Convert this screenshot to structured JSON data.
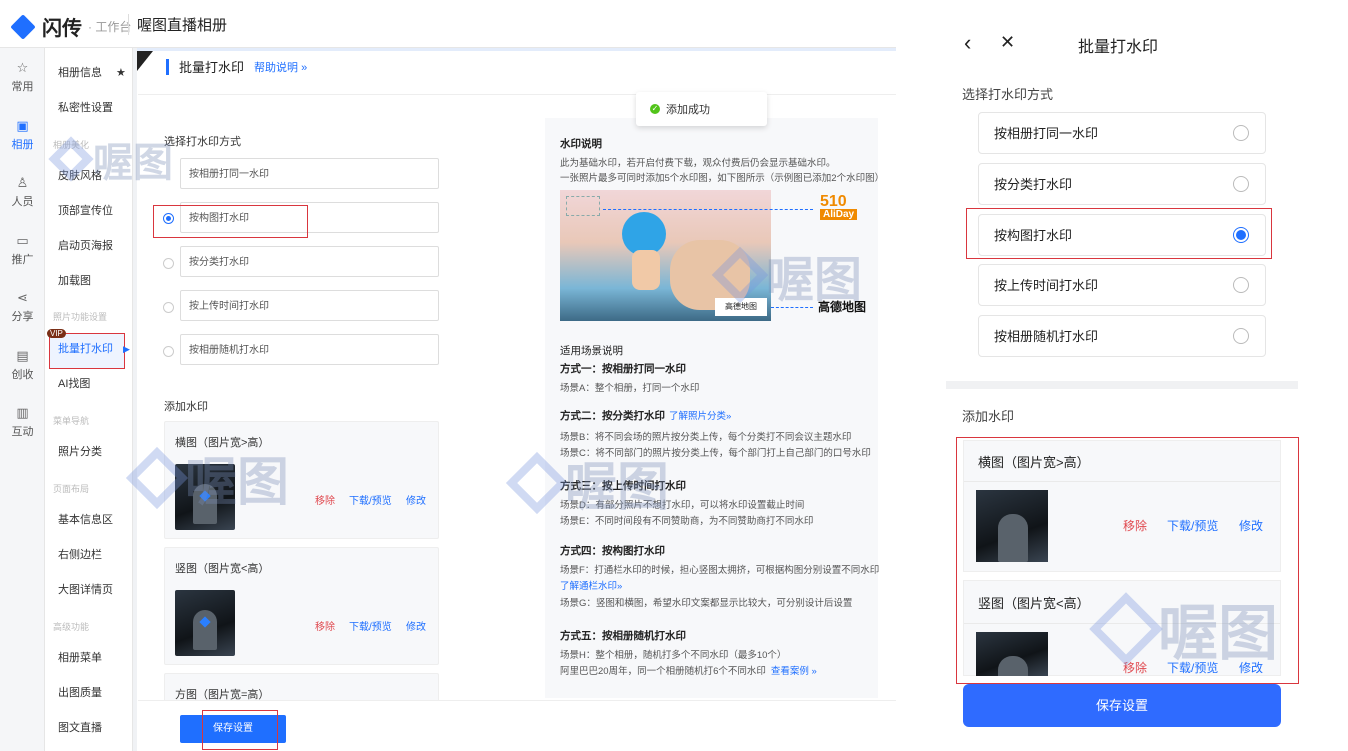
{
  "app": {
    "brand": "闪传",
    "brand_sub": "· 工作台",
    "title": "喔图直播相册"
  },
  "rail": [
    {
      "label": "常用",
      "icon": "star-icon"
    },
    {
      "label": "相册",
      "icon": "album-icon"
    },
    {
      "label": "人员",
      "icon": "user-icon"
    },
    {
      "label": "推广",
      "icon": "promote-icon"
    },
    {
      "label": "分享",
      "icon": "share-icon"
    },
    {
      "label": "创收",
      "icon": "revenue-icon"
    },
    {
      "label": "互动",
      "icon": "interact-icon"
    }
  ],
  "nav": {
    "items": [
      "相册信息",
      "私密性设置",
      "皮肤风格",
      "顶部宣传位",
      "启动页海报",
      "加载图",
      "批量打水印",
      "AI找图",
      "照片分类",
      "基本信息区",
      "右侧边栏",
      "大图详情页",
      "相册菜单",
      "出图质量",
      "图文直播"
    ],
    "groups": [
      "相册美化",
      "照片功能设置",
      "菜单导航",
      "页面布局",
      "高级功能"
    ],
    "vip": "VIP"
  },
  "main": {
    "title": "批量打水印",
    "help": "帮助说明 »",
    "toast": "添加成功",
    "choose_label": "选择打水印方式",
    "options": [
      "按相册打同一水印",
      "按构图打水印",
      "按分类打水印",
      "按上传时间打水印",
      "按相册随机打水印"
    ],
    "add_label": "添加水印",
    "cards": [
      {
        "title": "横图（图片宽>高）"
      },
      {
        "title": "竖图（图片宽<高）"
      },
      {
        "title": "方图（图片宽=高）"
      }
    ],
    "remove": "移除",
    "download": "下载/预览",
    "edit": "修改",
    "save": "保存设置"
  },
  "info": {
    "title": "水印说明",
    "line1": "此为基础水印，若开启付费下载，观众付费后仍会显示基础水印。",
    "line2": "一张照片最多可同时添加5个水印图，如下图所示（示例图已添加2个水印图）",
    "brand1": "510",
    "brand1_sub": "AliDay",
    "brand2": "高德地图",
    "brand2_small": "高德地图",
    "scene_title": "适用场景说明",
    "m1_title": "方式一：按相册打同一水印",
    "m1_a": "场景A：整个相册，打同一个水印",
    "m2_title": "方式二：按分类打水印",
    "m2_link": "了解照片分类»",
    "m2_b": "场景B：将不同会场的照片按分类上传，每个分类打不同会议主题水印",
    "m2_c": "场景C：将不同部门的照片按分类上传，每个部门打上自己部门的口号水印",
    "m3_title": "方式三：按上传时间打水印",
    "m3_d": "场景D：有部分照片不想打水印，可以将水印设置截止时间",
    "m3_e": "场景E：不同时间段有不同赞助商，为不同赞助商打不同水印",
    "m4_title": "方式四：按构图打水印",
    "m4_f": "场景F：打通栏水印的时候，担心竖图太拥挤，可根据构图分别设置不同水印",
    "m4_link": "了解通栏水印»",
    "m4_g": "场景G：竖图和横图，希望水印文案都显示比较大，可分别设计后设置",
    "m5_title": "方式五：按相册随机打水印",
    "m5_h": "场景H：整个相册，随机打多个不同水印（最多10个）",
    "m5_i": "阿里巴巴20周年，同一个相册随机打6个不同水印",
    "m5_link": "查看案例 »"
  },
  "watermark_text": "喔图",
  "phone": {
    "back": "‹",
    "close": "✕",
    "title": "批量打水印",
    "choose_label": "选择打水印方式",
    "options": [
      "按相册打同一水印",
      "按分类打水印",
      "按构图打水印",
      "按上传时间打水印",
      "按相册随机打水印"
    ],
    "selected_index": 2,
    "add_label": "添加水印",
    "cards": [
      {
        "title": "横图（图片宽>高）"
      },
      {
        "title": "竖图（图片宽<高）"
      }
    ],
    "remove": "移除",
    "download": "下载/预览",
    "edit": "修改",
    "save": "保存设置"
  },
  "colors": {
    "accent": "#1f6fff",
    "danger": "#e0484e",
    "highlight_border": "#d9363e"
  }
}
